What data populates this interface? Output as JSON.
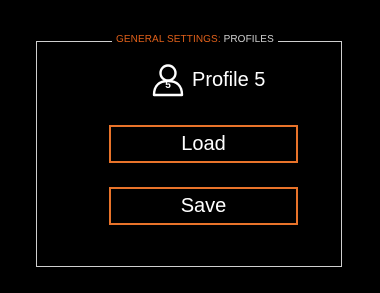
{
  "header": {
    "section": "GENERAL SETTINGS",
    "separator": ":",
    "page": "PROFILES"
  },
  "profile": {
    "icon": "user-profile-icon",
    "number": "5",
    "name": "Profile 5"
  },
  "buttons": {
    "load_label": "Load",
    "save_label": "Save"
  },
  "colors": {
    "background": "#000000",
    "accent": "#e8732a",
    "frame": "#cfcfcf",
    "text": "#ffffff"
  }
}
